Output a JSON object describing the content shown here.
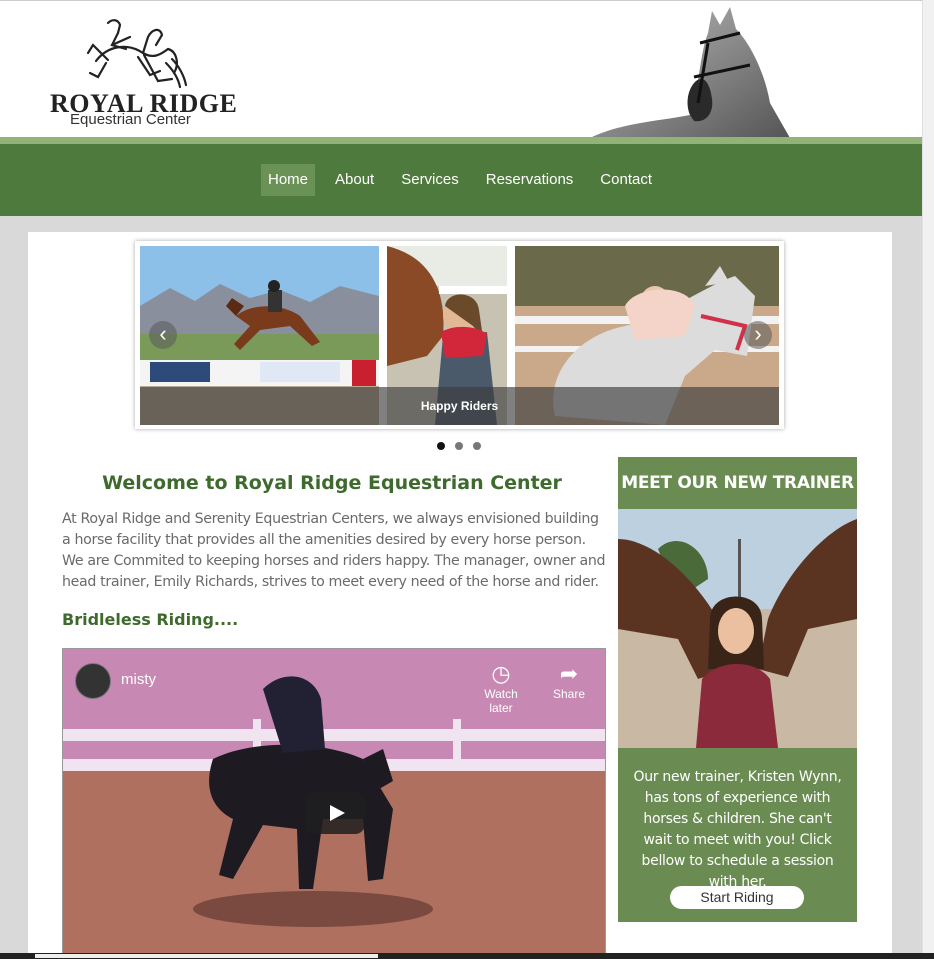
{
  "brand": {
    "name": "ROYAL RIDGE",
    "subtitle": "Equestrian Center"
  },
  "nav": {
    "items": [
      {
        "label": "Home",
        "active": true
      },
      {
        "label": "About"
      },
      {
        "label": "Services"
      },
      {
        "label": "Reservations"
      },
      {
        "label": "Contact"
      }
    ]
  },
  "slider": {
    "caption": "Happy Riders",
    "prev_icon": "chevron-left-icon",
    "next_icon": "chevron-right-icon",
    "dots": 3,
    "active_dot": 1
  },
  "main": {
    "welcome": "Welcome to Royal Ridge Equestrian Center",
    "intro": "At Royal Ridge and Serenity Equestrian Centers, we always envisioned building a horse facility that provides all the amenities desired by every horse person. We are Commited to keeping horses and riders happy. The manager, owner and head trainer, Emily Richards, strives to meet every need of the horse and rider.",
    "subheading": "Bridleless Riding....",
    "video": {
      "title": "misty",
      "watch_later": "Watch later",
      "share": "Share"
    }
  },
  "trainer": {
    "title": "MEET OUR NEW TRAINER",
    "text": "Our new trainer, Kristen Wynn, has tons of experience with horses & children. She can't wait to meet with you! Click bellow to schedule a session with her.",
    "button": "Start Riding"
  },
  "colors": {
    "nav_green": "#4f7a3d",
    "light_green": "#93b27a",
    "panel_green": "#6a8c52",
    "heading_green": "#3e6b2d"
  }
}
